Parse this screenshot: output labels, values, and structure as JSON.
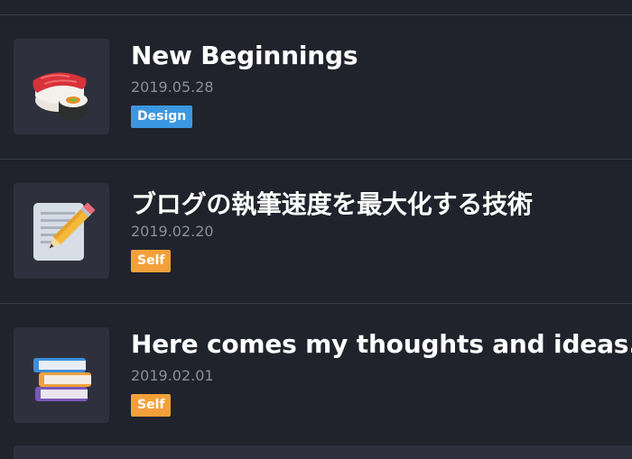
{
  "posts": [
    {
      "title": "New Beginnings",
      "date": "2019.05.28",
      "tag": {
        "label": "Design",
        "color": "#3b97e0"
      },
      "icon": "sushi-icon"
    },
    {
      "title": "ブログの執筆速度を最大化する技術",
      "date": "2019.02.20",
      "tag": {
        "label": "Self",
        "color": "#f3a03a"
      },
      "icon": "memo-pencil-icon"
    },
    {
      "title": "Here comes my thoughts and ideas.",
      "date": "2019.02.01",
      "tag": {
        "label": "Self",
        "color": "#f3a03a"
      },
      "icon": "books-icon"
    }
  ]
}
